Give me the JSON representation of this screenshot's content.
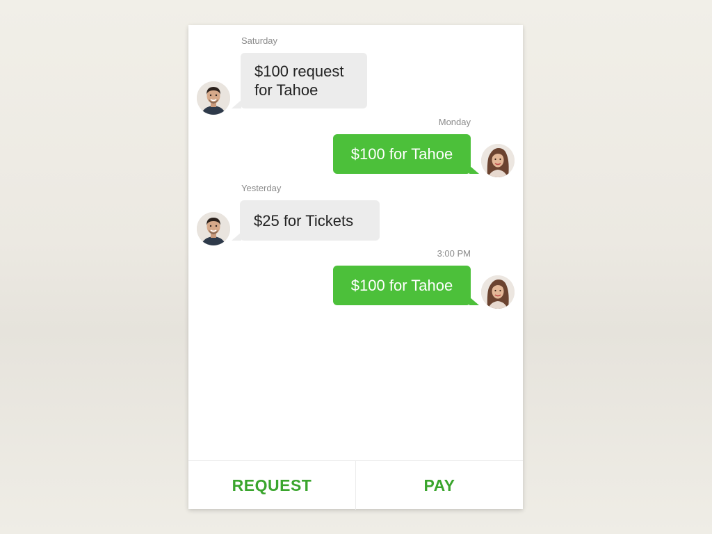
{
  "messages": [
    {
      "timestamp": "Saturday",
      "text": "$100 request for Tahoe",
      "direction": "incoming",
      "avatar": "man-avatar"
    },
    {
      "timestamp": "Monday",
      "text": "$100 for Tahoe",
      "direction": "outgoing",
      "avatar": "woman-avatar"
    },
    {
      "timestamp": "Yesterday",
      "text": "$25 for Tickets",
      "direction": "incoming",
      "avatar": "man-avatar"
    },
    {
      "timestamp": "3:00 PM",
      "text": "$100 for Tahoe",
      "direction": "outgoing",
      "avatar": "woman-avatar"
    }
  ],
  "actions": {
    "request_label": "REQUEST",
    "pay_label": "PAY"
  },
  "colors": {
    "accent_green": "#4cc03a",
    "button_green": "#3aa52d",
    "incoming_bubble": "#ececec"
  }
}
